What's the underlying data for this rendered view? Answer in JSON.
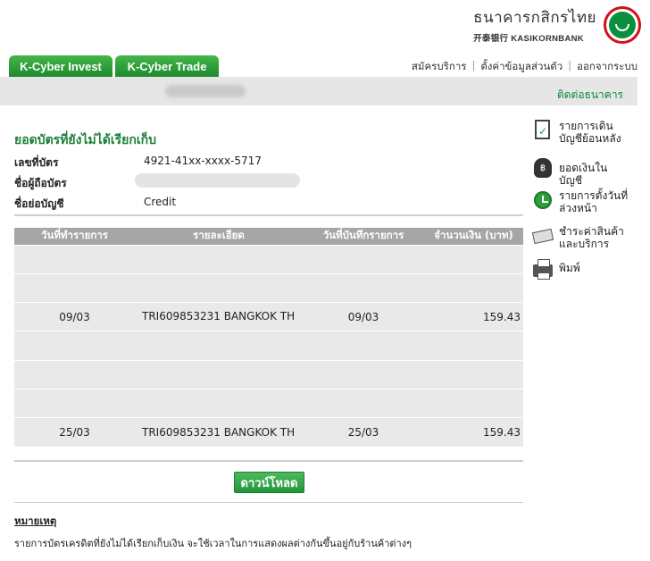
{
  "brand": {
    "name_th": "ธนาคารกสิกรไทย",
    "name_en": "开泰银行 KASIKORNBANK"
  },
  "tabs": [
    {
      "label": "K-Cyber Invest"
    },
    {
      "label": "K-Cyber Trade"
    }
  ],
  "top_links": [
    "สมัครบริการ",
    "ตั้งค่าข้อมูลส่วนตัว",
    "ออกจากระบบ"
  ],
  "contact_link": "ติดต่อธนาคาร",
  "page_title": "ยอดบัตรที่ยังไม่ได้เรียกเก็บ",
  "info": {
    "card_number_label": "เลขที่บัตร",
    "card_number_value": "4921-41xx-xxxx-5717",
    "holder_label": "ชื่อผู้ถือบัตร",
    "account_name_label": "ชื่อย่อบัญชี",
    "account_name_value": "Credit"
  },
  "table": {
    "headers": [
      "วันที่ทำรายการ",
      "รายละเอียด",
      "วันที่บันทึกรายการ",
      "จำนวนเงิน (บาท)"
    ],
    "rows": [
      {
        "date": "",
        "detail": "",
        "post_date": "",
        "amount": ""
      },
      {
        "date": "",
        "detail": "",
        "post_date": "",
        "amount": ""
      },
      {
        "date": "09/03",
        "detail": "TRI609853231 BANGKOK TH",
        "post_date": "09/03",
        "amount": "159.43"
      },
      {
        "date": "",
        "detail": "",
        "post_date": "",
        "amount": ""
      },
      {
        "date": "",
        "detail": "",
        "post_date": "",
        "amount": ""
      },
      {
        "date": "",
        "detail": "",
        "post_date": "",
        "amount": ""
      },
      {
        "date": "25/03",
        "detail": "TRI609853231 BANGKOK TH",
        "post_date": "25/03",
        "amount": "159.43"
      }
    ]
  },
  "download_label": "ดาวน์โหลด",
  "note": {
    "heading": "หมายเหตุ",
    "text": "รายการบัตรเครดิตที่ยังไม่ได้เรียกเก็บเงิน จะใช้เวลาในการแสดงผลต่างกันขึ้นอยู่กับร้านค้าต่างๆ"
  },
  "side_menu": [
    {
      "label": "รายการเดินบัญชีย้อนหลัง",
      "icon": "statement-check-icon"
    },
    {
      "label": "ยอดเงินในบัญชี",
      "icon": "money-bag-icon"
    },
    {
      "label": "รายการตั้งวันที่ล่วงหน้า",
      "icon": "clock-icon"
    },
    {
      "label": "ชำระค่าสินค้าและบริการ",
      "icon": "payment-card-icon"
    },
    {
      "label": "พิมพ์",
      "icon": "printer-icon"
    }
  ],
  "colors": {
    "brand_green": "#1a7f37",
    "tab_green": "#2e9e3c",
    "logo_red": "#d4101a",
    "table_header": "#a6a6a6",
    "row_bg": "#e9e9e9"
  }
}
